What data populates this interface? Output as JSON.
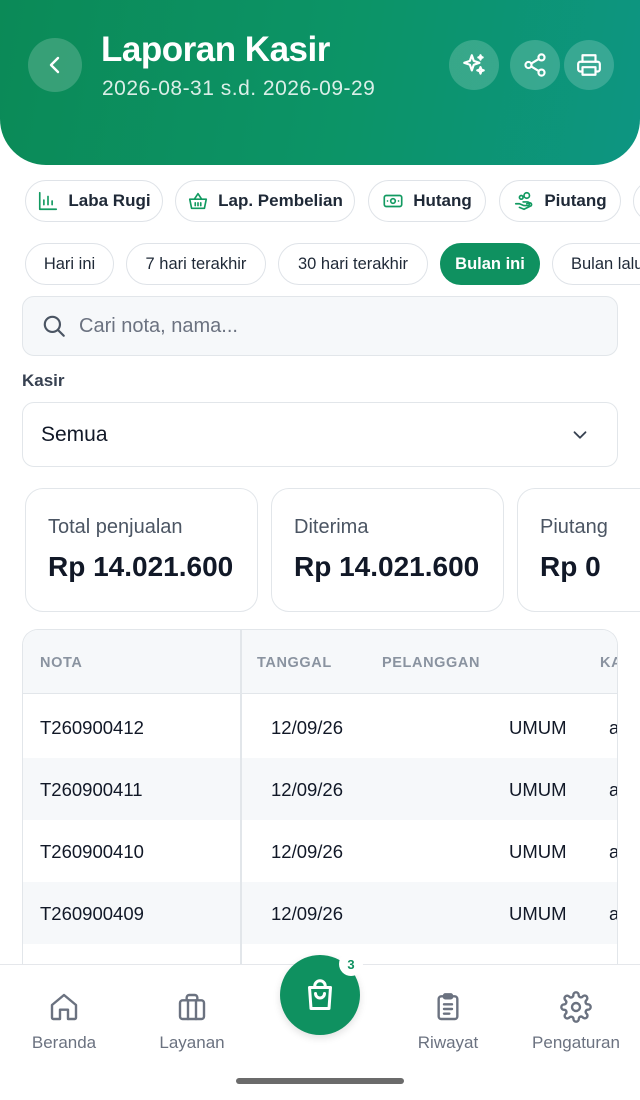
{
  "header": {
    "title": "Laporan Kasir",
    "date_range": "2026-08-31 s.d. 2026-09-29",
    "icons": [
      "chevron-left-icon",
      "sparkle-icon",
      "share-icon",
      "printer-icon"
    ]
  },
  "report_chips": [
    {
      "label": "Laba Rugi",
      "icon": "bar-chart-icon"
    },
    {
      "label": "Lap. Pembelian",
      "icon": "basket-icon"
    },
    {
      "label": "Hutang",
      "icon": "banknote-icon"
    },
    {
      "label": "Piutang",
      "icon": "hand-coins-icon"
    }
  ],
  "period_chips": [
    "Hari ini",
    "7 hari terakhir",
    "30 hari terakhir",
    "Bulan ini",
    "Bulan lalu"
  ],
  "active_period": "Bulan ini",
  "search": {
    "placeholder": "Cari nota, nama..."
  },
  "kasir": {
    "label": "Kasir",
    "selected": "Semua"
  },
  "summary": [
    {
      "label": "Total penjualan",
      "value": "Rp 14.021.600"
    },
    {
      "label": "Diterima",
      "value": "Rp 14.021.600"
    },
    {
      "label": "Piutang",
      "value": "Rp 0"
    }
  ],
  "table": {
    "columns": [
      "NOTA",
      "TANGGAL",
      "PELANGGAN",
      "KA"
    ],
    "rows": [
      {
        "nota": "T260900412",
        "tanggal": "12/09/26",
        "pelanggan": "UMUM",
        "kasir": "a"
      },
      {
        "nota": "T260900411",
        "tanggal": "12/09/26",
        "pelanggan": "UMUM",
        "kasir": "a"
      },
      {
        "nota": "T260900410",
        "tanggal": "12/09/26",
        "pelanggan": "UMUM",
        "kasir": "a"
      },
      {
        "nota": "T260900409",
        "tanggal": "12/09/26",
        "pelanggan": "UMUM",
        "kasir": "a"
      }
    ]
  },
  "bottom_nav": {
    "items": [
      {
        "label": "Beranda",
        "icon": "home-icon"
      },
      {
        "label": "Layanan",
        "icon": "briefcase-icon"
      },
      {
        "label": "Riwayat",
        "icon": "clipboard-list-icon"
      },
      {
        "label": "Pengaturan",
        "icon": "gear-icon"
      }
    ],
    "cart_badge": "3",
    "cart_icon": "shopping-bag-icon"
  },
  "colors": {
    "primary": "#0f9160",
    "header_gradient_end": "#0d9582",
    "text": "#111827",
    "muted": "#6b7280"
  }
}
